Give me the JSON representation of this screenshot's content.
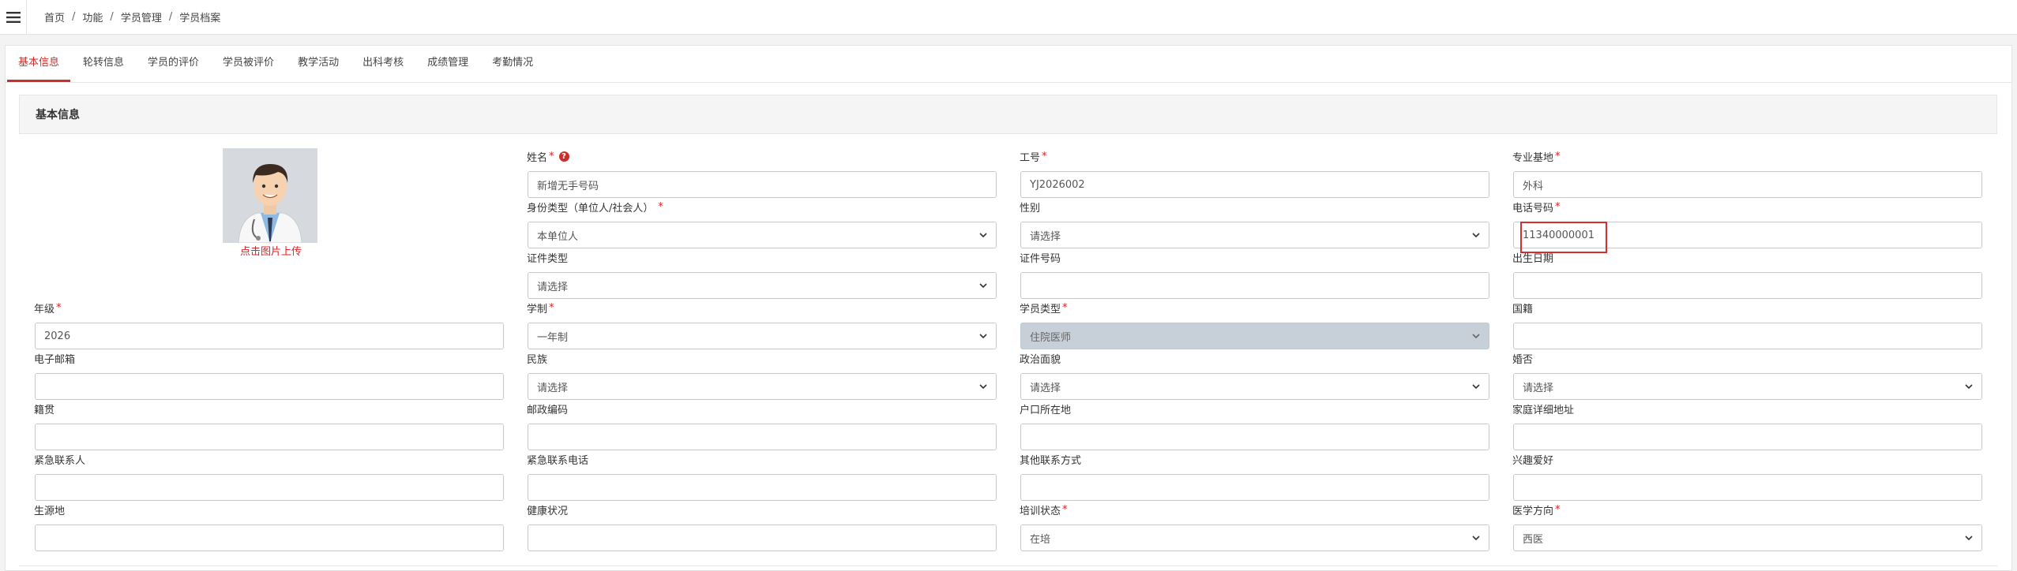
{
  "breadcrumb": [
    "首页",
    "功能",
    "学员管理",
    "学员档案"
  ],
  "tabs": [
    "基本信息",
    "轮转信息",
    "学员的评价",
    "学员被评价",
    "教学活动",
    "出科考核",
    "成绩管理",
    "考勤情况"
  ],
  "section_title": "基本信息",
  "photo_caption": "点击图片上传",
  "accent_color": "#c9302c",
  "fields": {
    "name": {
      "label": "姓名",
      "value": "新增无手号码"
    },
    "job_no": {
      "label": "工号",
      "value": "YJ2026002"
    },
    "base": {
      "label": "专业基地",
      "value": "外科"
    },
    "identity_type": {
      "label": "身份类型（单位人/社会人）",
      "value": "本单位人"
    },
    "gender": {
      "label": "性别",
      "value": "请选择"
    },
    "phone": {
      "label": "电话号码",
      "value": "11340000001"
    },
    "id_type": {
      "label": "证件类型",
      "value": "请选择"
    },
    "id_no": {
      "label": "证件号码",
      "value": ""
    },
    "birth": {
      "label": "出生日期",
      "value": ""
    },
    "grade": {
      "label": "年级",
      "value": "2026"
    },
    "schooling": {
      "label": "学制",
      "value": "一年制"
    },
    "student_type": {
      "label": "学员类型",
      "value": "住院医师"
    },
    "nationality": {
      "label": "国籍",
      "value": ""
    },
    "email": {
      "label": "电子邮箱",
      "value": ""
    },
    "ethnicity": {
      "label": "民族",
      "value": "请选择"
    },
    "politics": {
      "label": "政治面貌",
      "value": "请选择"
    },
    "marital": {
      "label": "婚否",
      "value": "请选择"
    },
    "native_place": {
      "label": "籍贯",
      "value": ""
    },
    "postcode": {
      "label": "邮政编码",
      "value": ""
    },
    "hukou": {
      "label": "户口所在地",
      "value": ""
    },
    "address": {
      "label": "家庭详细地址",
      "value": ""
    },
    "emergency_contact": {
      "label": "紧急联系人",
      "value": ""
    },
    "emergency_phone": {
      "label": "紧急联系电话",
      "value": ""
    },
    "other_contact": {
      "label": "其他联系方式",
      "value": ""
    },
    "hobby": {
      "label": "兴趣爱好",
      "value": ""
    },
    "origin": {
      "label": "生源地",
      "value": ""
    },
    "health": {
      "label": "健康状况",
      "value": ""
    },
    "training_status": {
      "label": "培训状态",
      "value": "在培"
    },
    "medical_direction": {
      "label": "医学方向",
      "value": "西医"
    }
  }
}
